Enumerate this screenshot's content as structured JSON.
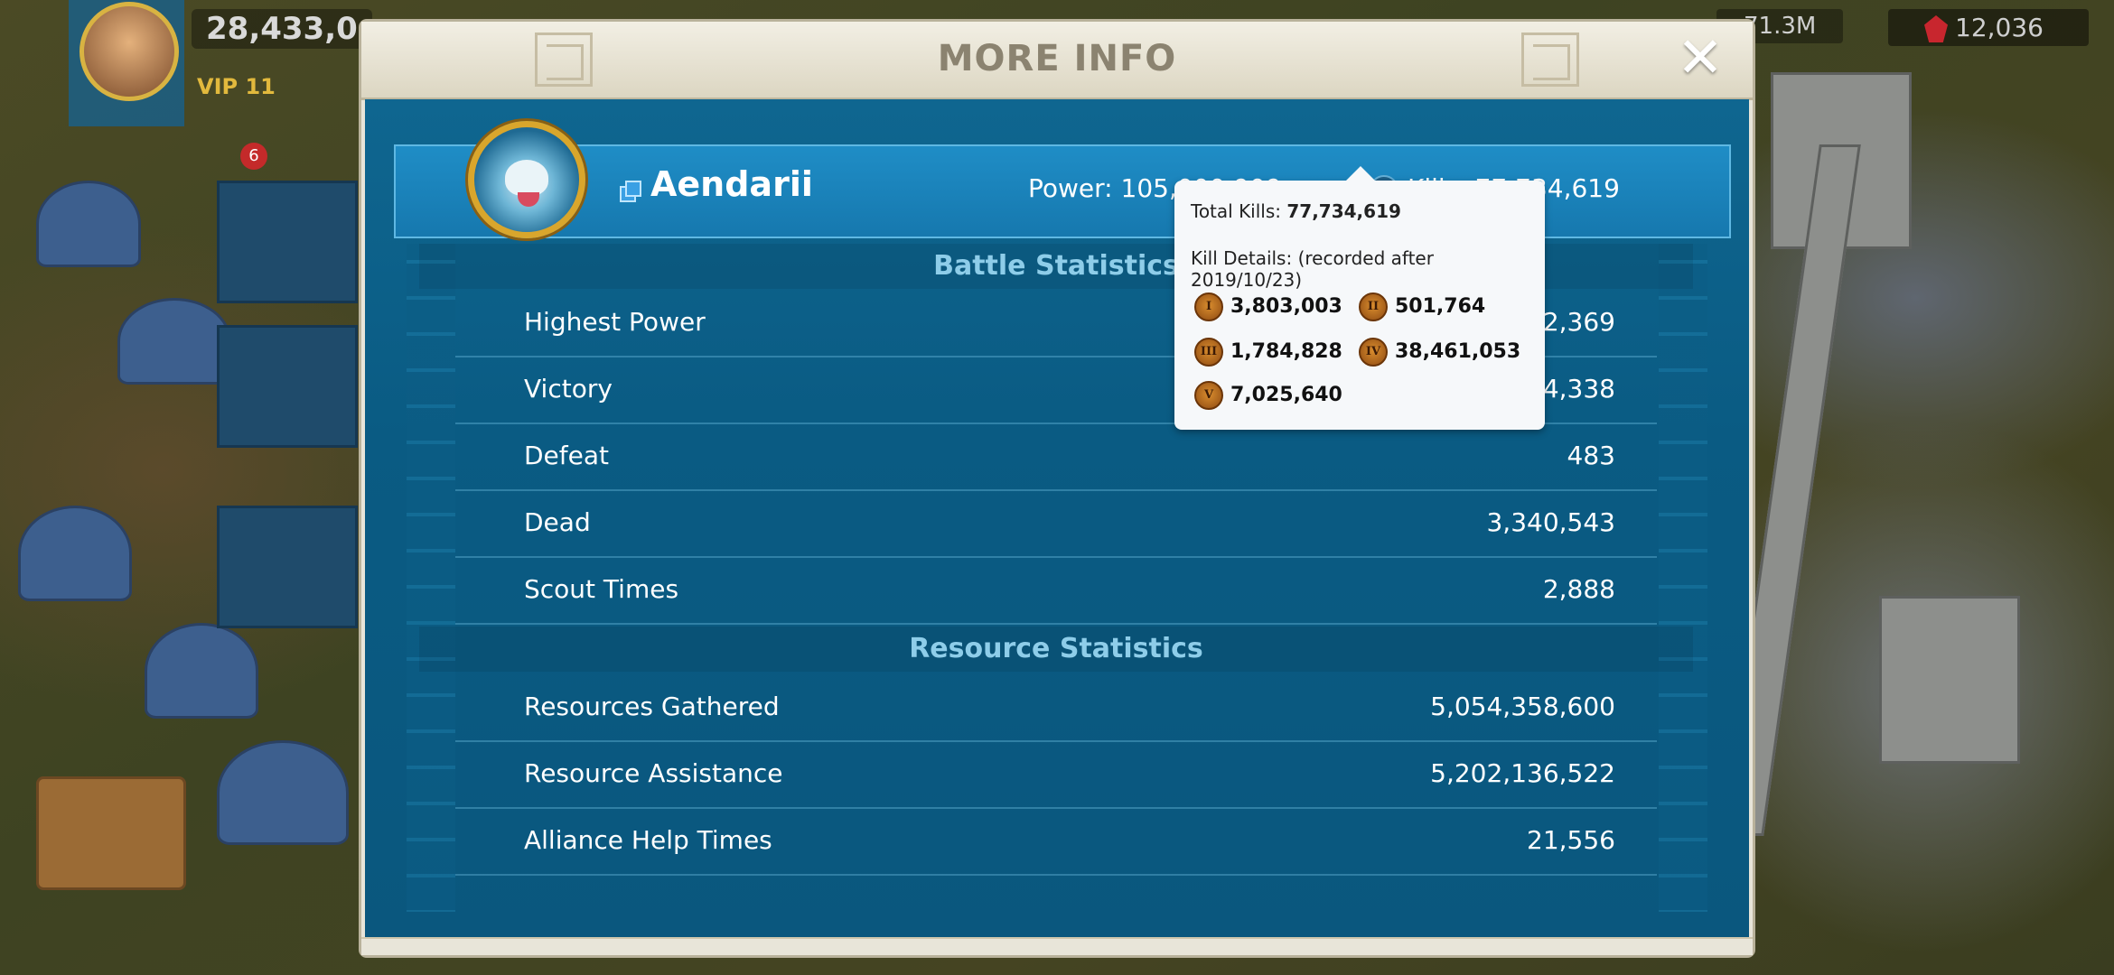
{
  "hud": {
    "power": "28,433,0",
    "vip": "VIP 11",
    "notification_count": "6",
    "resource_1": "71.3M",
    "gems": "12,036"
  },
  "modal": {
    "title": "MORE INFO",
    "profile": {
      "name": "Aendarii",
      "power_text": "Power: 105,000,909",
      "kills_text": "Kills: 77,734,619"
    },
    "battle_section_title": "Battle Statistics",
    "battle_stats": [
      {
        "label": "Highest Power",
        "value": "105,002,369"
      },
      {
        "label": "Victory",
        "value": "34,338"
      },
      {
        "label": "Defeat",
        "value": "483"
      },
      {
        "label": "Dead",
        "value": "3,340,543"
      },
      {
        "label": "Scout Times",
        "value": "2,888"
      }
    ],
    "resource_section_title": "Resource Statistics",
    "resource_stats": [
      {
        "label": "Resources Gathered",
        "value": "5,054,358,600"
      },
      {
        "label": "Resource Assistance",
        "value": "5,202,136,522"
      },
      {
        "label": "Alliance Help Times",
        "value": "21,556"
      }
    ]
  },
  "tooltip": {
    "total_label": "Total Kills: ",
    "total_value": "77,734,619",
    "details_label": "Kill Details: (recorded after 2019/10/23)",
    "tiers": [
      {
        "tier": "I",
        "value": "3,803,003"
      },
      {
        "tier": "II",
        "value": "501,764"
      },
      {
        "tier": "III",
        "value": "1,784,828"
      },
      {
        "tier": "IV",
        "value": "38,461,053"
      },
      {
        "tier": "V",
        "value": "7,025,640"
      }
    ]
  }
}
